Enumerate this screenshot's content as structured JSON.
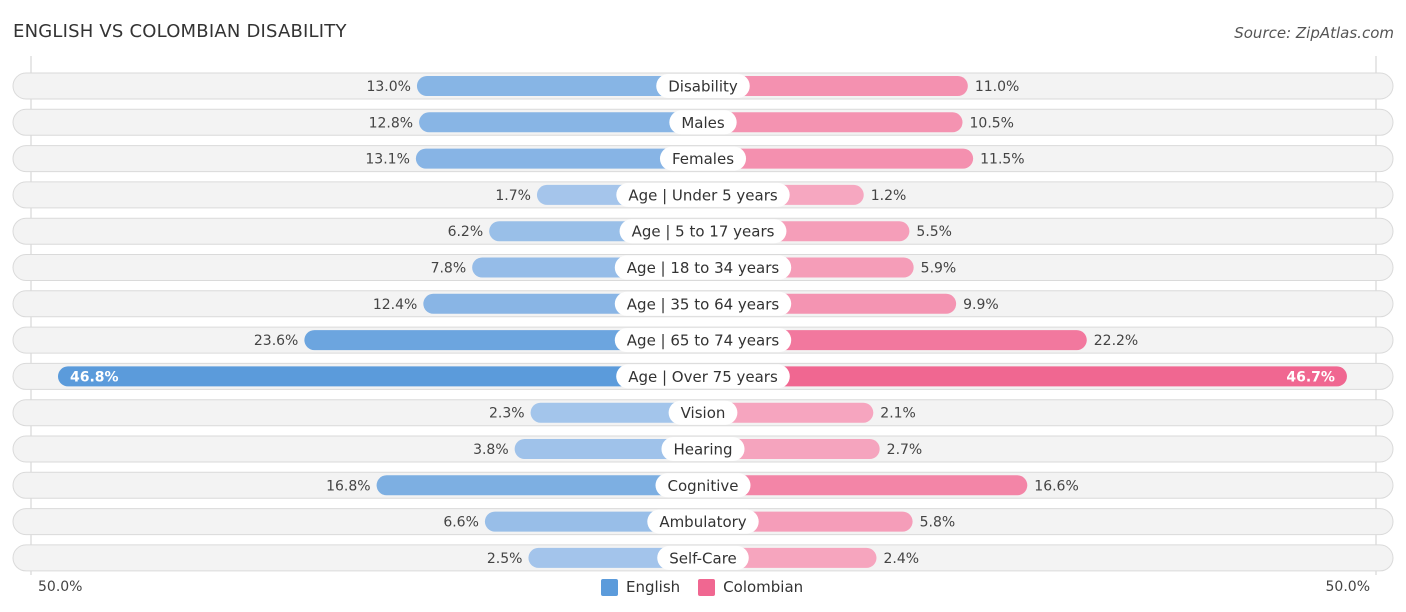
{
  "header": {
    "title": "ENGLISH VS COLOMBIAN DISABILITY",
    "source": "Source: ZipAtlas.com"
  },
  "axis": {
    "left_label": "50.0%",
    "right_label": "50.0%"
  },
  "legend": [
    {
      "name": "English",
      "color": "#5b9bdb"
    },
    {
      "name": "Colombian",
      "color": "#f06791"
    }
  ],
  "chart_data": {
    "type": "bar",
    "orientation": "horizontal-diverging",
    "title": "ENGLISH VS COLOMBIAN DISABILITY",
    "xlabel": "",
    "ylabel": "",
    "xlim": [
      0,
      50
    ],
    "unit": "%",
    "legend_position": "bottom-center",
    "categories": [
      "Disability",
      "Males",
      "Females",
      "Age | Under 5 years",
      "Age | 5 to 17 years",
      "Age | 18 to 34 years",
      "Age | 35 to 64 years",
      "Age | 65 to 74 years",
      "Age | Over 75 years",
      "Vision",
      "Hearing",
      "Cognitive",
      "Ambulatory",
      "Self-Care"
    ],
    "series": [
      {
        "name": "English",
        "side": "left",
        "values": [
          13.0,
          12.8,
          13.1,
          1.7,
          6.2,
          7.8,
          12.4,
          23.6,
          46.8,
          2.3,
          3.8,
          16.8,
          6.6,
          2.5
        ],
        "labels": [
          "13.0%",
          "12.8%",
          "13.1%",
          "1.7%",
          "6.2%",
          "7.8%",
          "12.4%",
          "23.6%",
          "46.8%",
          "2.3%",
          "3.8%",
          "16.8%",
          "6.6%",
          "2.5%"
        ]
      },
      {
        "name": "Colombian",
        "side": "right",
        "values": [
          11.0,
          10.5,
          11.5,
          1.2,
          5.5,
          5.9,
          9.9,
          22.2,
          46.7,
          2.1,
          2.7,
          16.6,
          5.8,
          2.4
        ],
        "labels": [
          "11.0%",
          "10.5%",
          "11.5%",
          "1.2%",
          "5.5%",
          "5.9%",
          "9.9%",
          "22.2%",
          "46.7%",
          "2.1%",
          "2.7%",
          "16.6%",
          "5.8%",
          "2.4%"
        ]
      }
    ],
    "colors": {
      "english_light": "#a9c8ec",
      "english_strong": "#5b9bdb",
      "colombian_light": "#f6aac2",
      "colombian_strong": "#f06791"
    }
  }
}
